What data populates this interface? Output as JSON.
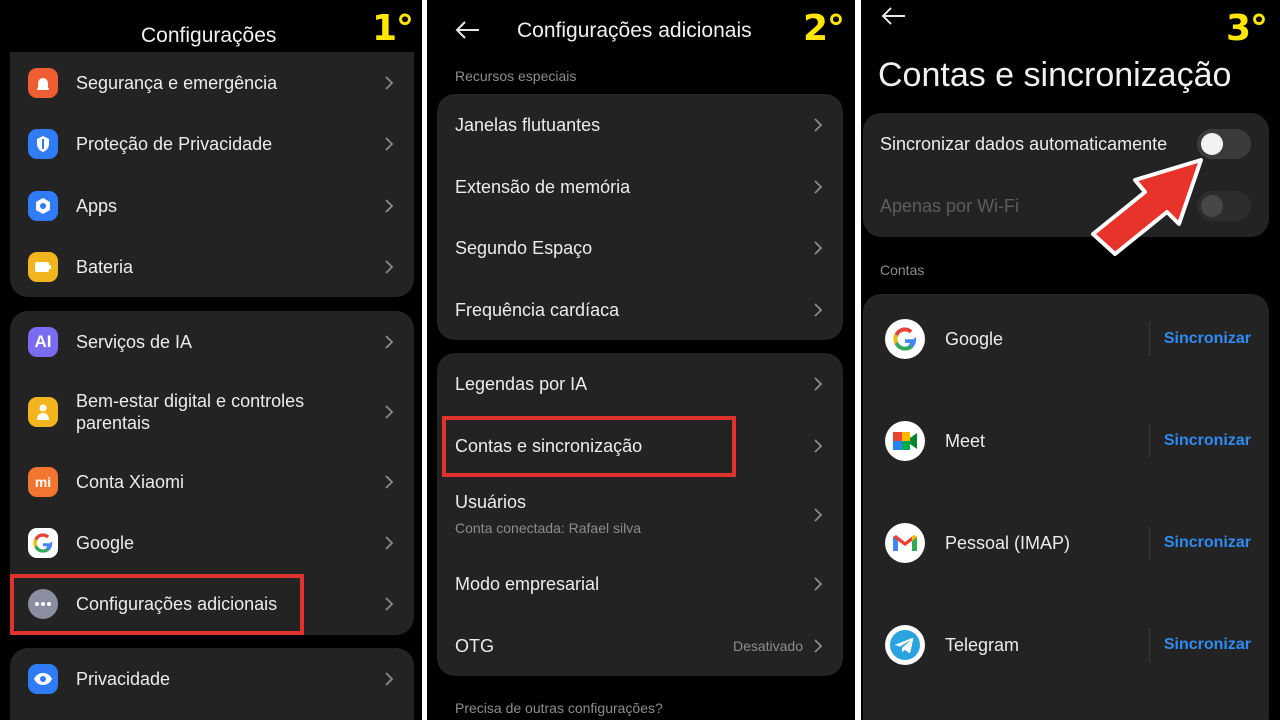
{
  "panel1": {
    "step": "1°",
    "title": "Configurações",
    "items_group1": [
      {
        "label": "Segurança e emergência",
        "icon": "emergency-icon",
        "color": "#ef5d32"
      },
      {
        "label": "Proteção de Privacidade",
        "icon": "shield-icon",
        "color": "#2f7cf6"
      },
      {
        "label": "Apps",
        "icon": "apps-icon",
        "color": "#2f7cf6"
      },
      {
        "label": "Bateria",
        "icon": "battery-icon",
        "color": "#f2b51d"
      }
    ],
    "items_group2": [
      {
        "label": "Serviços de IA",
        "icon": "ai-icon",
        "color": "#7a6cf0",
        "glyph": "AI"
      },
      {
        "label": "Bem-estar digital e controles parentais",
        "icon": "wellbeing-icon",
        "color": "#f2b51d"
      },
      {
        "label": "Conta Xiaomi",
        "icon": "xiaomi-icon",
        "color": "#f2762f",
        "glyph": "mi"
      },
      {
        "label": "Google",
        "icon": "google-icon",
        "color": "#ffffff"
      },
      {
        "label": "Configurações adicionais",
        "icon": "more-icon",
        "color": "#8a8ea0"
      }
    ],
    "items_group3": [
      {
        "label": "Privacidade",
        "icon": "eye-icon",
        "color": "#2f7cf6"
      }
    ]
  },
  "panel2": {
    "step": "2°",
    "title": "Configurações adicionais",
    "section": "Recursos especiais",
    "items_group1": [
      {
        "label": "Janelas flutuantes"
      },
      {
        "label": "Extensão de memória"
      },
      {
        "label": "Segundo Espaço"
      },
      {
        "label": "Frequência cardíaca"
      }
    ],
    "items_group2": [
      {
        "label": "Legendas por IA"
      },
      {
        "label": "Contas e sincronização"
      },
      {
        "label": "Usuários",
        "sub": "Conta conectada: Rafael silva"
      },
      {
        "label": "Modo empresarial"
      },
      {
        "label": "OTG",
        "trail": "Desativado"
      }
    ],
    "footer": "Precisa de outras configurações?"
  },
  "panel3": {
    "step": "3°",
    "title": "Contas e sincronização",
    "auto_sync_label": "Sincronizar dados automaticamente",
    "wifi_only_label": "Apenas por Wi-Fi",
    "auto_sync_on": false,
    "wifi_only_on": false,
    "accounts_label": "Contas",
    "accounts": [
      {
        "name": "Google",
        "icon": "google-icon",
        "action": "Sincronizar"
      },
      {
        "name": "Meet",
        "icon": "meet-icon",
        "action": "Sincronizar"
      },
      {
        "name": "Pessoal (IMAP)",
        "icon": "gmail-icon",
        "action": "Sincronizar"
      },
      {
        "name": "Telegram",
        "icon": "telegram-icon",
        "action": "Sincronizar"
      }
    ]
  },
  "colors": {
    "highlight": "#e1332d",
    "step": "#ffe600",
    "link": "#2f8bf5"
  }
}
